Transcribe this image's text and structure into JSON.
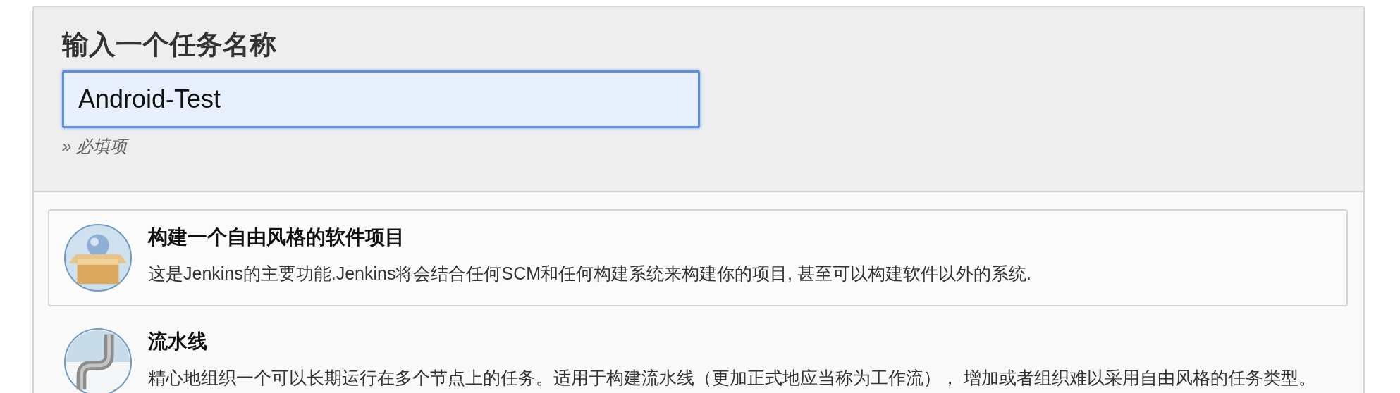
{
  "header": {
    "title": "输入一个任务名称",
    "name_field": {
      "value": "Android-Test",
      "focused": true
    },
    "hint": "» 必填项"
  },
  "items": [
    {
      "kind": "freestyle",
      "title": "构建一个自由风格的软件项目",
      "description": "这是Jenkins的主要功能.Jenkins将会结合任何SCM和任何构建系统来构建你的项目, 甚至可以构建软件以外的系统.",
      "selected": false,
      "hovered": true
    },
    {
      "kind": "pipeline",
      "title": "流水线",
      "description": "精心地组织一个可以长期运行在多个节点上的任务。适用于构建流水线（更加正式地应当称为工作流）， 增加或者组织难以采用自由风格的任务类型。",
      "selected": false,
      "hovered": false
    }
  ]
}
